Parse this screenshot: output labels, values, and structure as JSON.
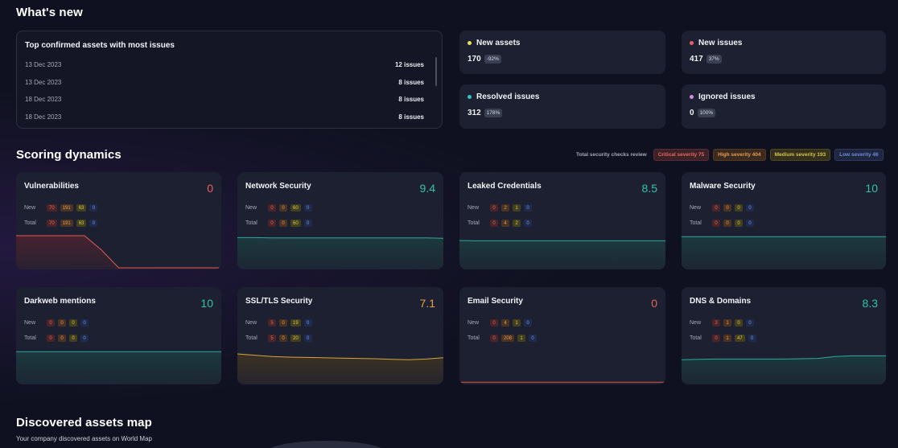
{
  "whats_new": {
    "title": "What's new",
    "top_assets": {
      "title": "Top confirmed assets with most issues",
      "rows": [
        {
          "date": "13 Dec 2023",
          "count": "12 issues"
        },
        {
          "date": "13 Dec 2023",
          "count": "8 issues"
        },
        {
          "date": "18 Dec 2023",
          "count": "8 issues"
        },
        {
          "date": "18 Dec 2023",
          "count": "8 issues"
        }
      ]
    },
    "stats": [
      {
        "label": "New assets",
        "value": "170",
        "change": "-92%",
        "color": "#e8e05a"
      },
      {
        "label": "New issues",
        "value": "417",
        "change": "37%",
        "color": "#e85f6a"
      },
      {
        "label": "Resolved issues",
        "value": "312",
        "change": "178%",
        "color": "#2fc6c0"
      },
      {
        "label": "Ignored issues",
        "value": "0",
        "change": "100%",
        "color": "#d68ae8"
      }
    ]
  },
  "scoring": {
    "title": "Scoring dynamics",
    "legend": {
      "caption": "Total security checks review",
      "critical": "Critical severity 75",
      "high": "High severity 404",
      "medium": "Medium severity 193",
      "low": "Low severity 46"
    },
    "row_labels": {
      "new": "New",
      "total": "Total"
    },
    "cards": [
      {
        "name": "Vulnerabilities",
        "score": "0",
        "score_color": "#e5645c",
        "new": [
          "70",
          "191",
          "63",
          "0"
        ],
        "total": [
          "70",
          "191",
          "63",
          "0"
        ],
        "trend": [
          1.0,
          1.0,
          1.0,
          1.0,
          1.0,
          0.55,
          0.0,
          0.0,
          0.0,
          0.0,
          0.0,
          0.0,
          0.0
        ],
        "line": "#e05a52",
        "fill": "#4a2330"
      },
      {
        "name": "Network Security",
        "score": "9.4",
        "score_color": "#2fc3a8",
        "new": [
          "0",
          "0",
          "60",
          "0"
        ],
        "total": [
          "0",
          "0",
          "60",
          "0"
        ],
        "trend": [
          0.94,
          0.94,
          0.93,
          0.93,
          0.93,
          0.93,
          0.93,
          0.93,
          0.93,
          0.93,
          0.93,
          0.93,
          0.92
        ],
        "line": "#2fa89a",
        "fill": "#1c3a40"
      },
      {
        "name": "Leaked Credentials",
        "score": "8.5",
        "score_color": "#2fc3a8",
        "new": [
          "0",
          "2",
          "1",
          "0"
        ],
        "total": [
          "0",
          "4",
          "2",
          "0"
        ],
        "trend": [
          0.85,
          0.84,
          0.84,
          0.84,
          0.84,
          0.84,
          0.84,
          0.84,
          0.84,
          0.84,
          0.84,
          0.84,
          0.84
        ],
        "line": "#2fa89a",
        "fill": "#1c3a40"
      },
      {
        "name": "Malware Security",
        "score": "10",
        "score_color": "#2fc3a8",
        "new": [
          "0",
          "0",
          "0",
          "0"
        ],
        "total": [
          "0",
          "0",
          "0",
          "0"
        ],
        "trend": [
          0.97,
          0.97,
          0.97,
          0.97,
          0.97,
          0.97,
          0.97,
          0.97,
          0.97,
          0.97,
          0.97,
          0.97,
          0.97
        ],
        "line": "#2fa89a",
        "fill": "#1c3a40"
      },
      {
        "name": "Darkweb mentions",
        "score": "10",
        "score_color": "#2fc3a8",
        "new": [
          "0",
          "0",
          "0",
          "0"
        ],
        "total": [
          "0",
          "0",
          "0",
          "0"
        ],
        "trend": [
          0.97,
          0.97,
          0.97,
          0.97,
          0.97,
          0.97,
          0.97,
          0.97,
          0.97,
          0.97,
          0.97,
          0.97,
          0.97
        ],
        "line": "#2fa89a",
        "fill": "#1c3a40"
      },
      {
        "name": "SSL/TLS Security",
        "score": "7.1",
        "score_color": "#e6a23c",
        "new": [
          "5",
          "0",
          "19",
          "0"
        ],
        "total": [
          "5",
          "0",
          "20",
          "0"
        ],
        "trend": [
          0.9,
          0.86,
          0.82,
          0.8,
          0.79,
          0.78,
          0.77,
          0.76,
          0.75,
          0.73,
          0.72,
          0.74,
          0.78
        ],
        "line": "#d6a33a",
        "fill": "#3d3324"
      },
      {
        "name": "Email Security",
        "score": "0",
        "score_color": "#e5645c",
        "new": [
          "0",
          "4",
          "1",
          "0"
        ],
        "total": [
          "0",
          "208",
          "1",
          "0"
        ],
        "trend": [
          0.02,
          0.02,
          0.02,
          0.02,
          0.02,
          0.02,
          0.02,
          0.02,
          0.02,
          0.02,
          0.02,
          0.02,
          0.02
        ],
        "line": "#d4564e",
        "fill": "#2a1f2a"
      },
      {
        "name": "DNS & Domains",
        "score": "8.3",
        "score_color": "#2fc3a8",
        "new": [
          "3",
          "1",
          "0",
          "0"
        ],
        "total": [
          "0",
          "1",
          "47",
          "0"
        ],
        "trend": [
          0.72,
          0.73,
          0.74,
          0.74,
          0.74,
          0.74,
          0.74,
          0.75,
          0.76,
          0.82,
          0.84,
          0.84,
          0.84
        ],
        "line": "#2fa89a",
        "fill": "#1c3a40"
      }
    ]
  },
  "map": {
    "title": "Discovered assets map",
    "subtitle": "Your company discovered assets on World Map"
  }
}
